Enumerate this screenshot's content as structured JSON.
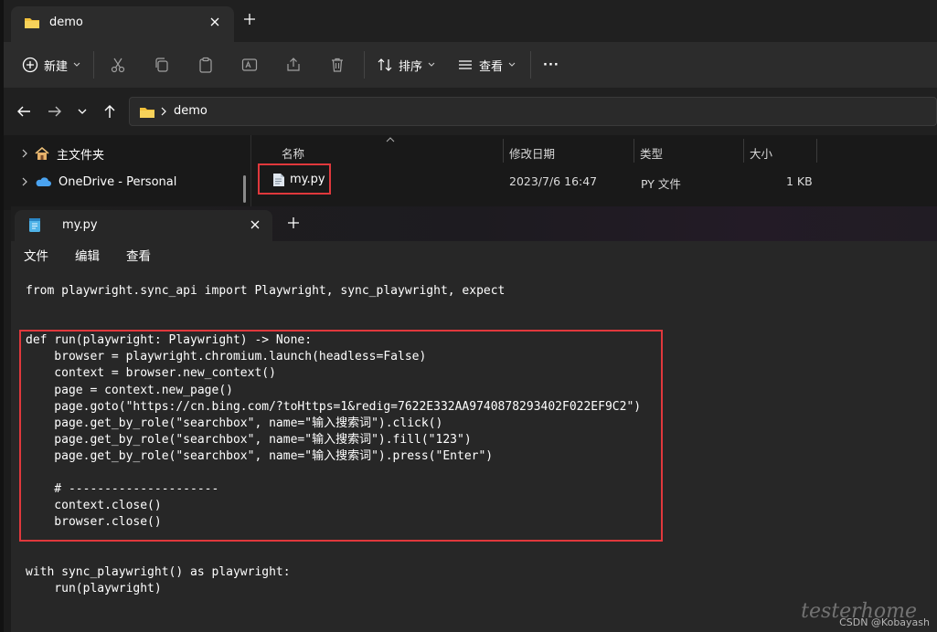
{
  "explorer": {
    "tab_title": "demo",
    "toolbar": {
      "new_label": "新建",
      "sort_label": "排序",
      "view_label": "查看",
      "more_label": "···"
    },
    "address": {
      "crumb": "demo"
    },
    "nav": [
      {
        "label": "主文件夹"
      },
      {
        "label": "OneDrive - Personal"
      }
    ],
    "columns": {
      "name": "名称",
      "modified": "修改日期",
      "type": "类型",
      "size": "大小"
    },
    "files": [
      {
        "name": "my.py",
        "modified": "2023/7/6 16:47",
        "type": "PY 文件",
        "size": "1 KB"
      }
    ]
  },
  "notepad": {
    "tab_title": "my.py",
    "menu": {
      "file": "文件",
      "edit": "编辑",
      "view": "查看"
    },
    "code": "from playwright.sync_api import Playwright, sync_playwright, expect\n\n\ndef run(playwright: Playwright) -> None:\n    browser = playwright.chromium.launch(headless=False)\n    context = browser.new_context()\n    page = context.new_page()\n    page.goto(\"https://cn.bing.com/?toHttps=1&redig=7622E332AA9740878293402F022EF9C2\")\n    page.get_by_role(\"searchbox\", name=\"输入搜索词\").click()\n    page.get_by_role(\"searchbox\", name=\"输入搜索词\").fill(\"123\")\n    page.get_by_role(\"searchbox\", name=\"输入搜索词\").press(\"Enter\")\n\n    # ---------------------\n    context.close()\n    browser.close()\n\n\nwith sync_playwright() as playwright:\n    run(playwright)"
  },
  "watermark": "CSDN @Kobayash",
  "watermark_script": "testerhome",
  "colors": {
    "highlight": "#e0383c",
    "folder": "#f3c13a",
    "onedrive": "#4aa3f0"
  }
}
